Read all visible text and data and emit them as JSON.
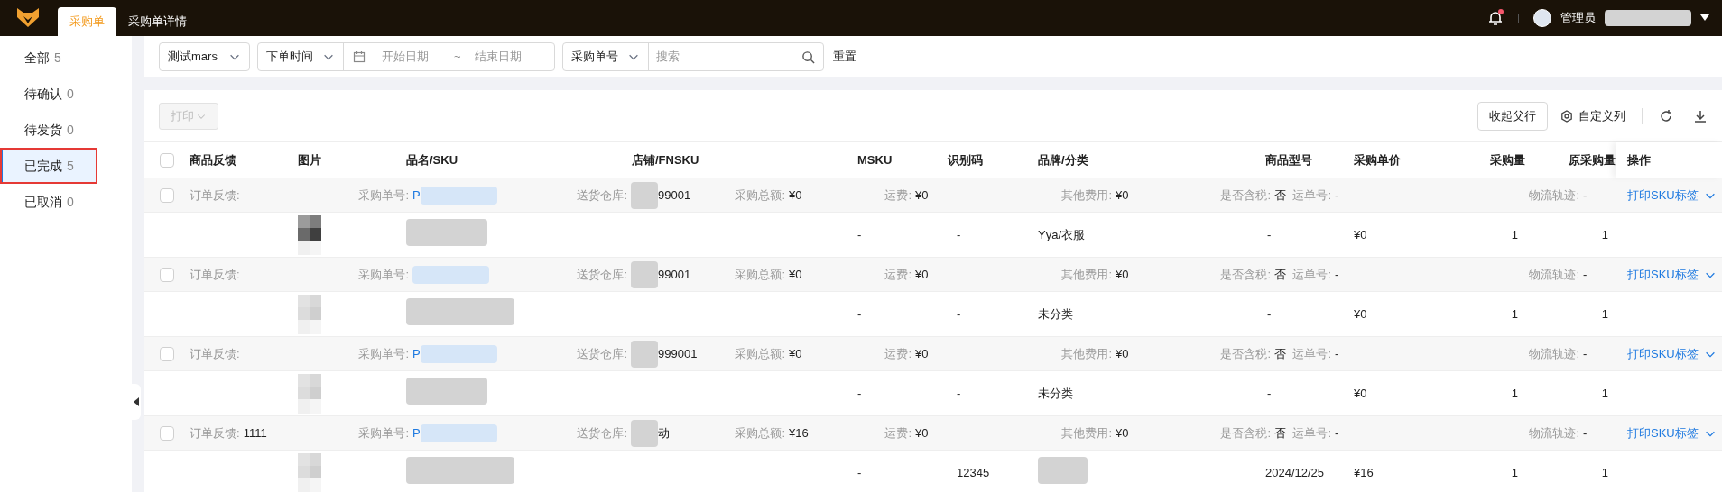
{
  "topbar": {
    "tabs": [
      {
        "label": "采购单",
        "selected": true
      },
      {
        "label": "采购单详情",
        "selected": false
      }
    ],
    "notification": {
      "unread": true
    },
    "user": {
      "name": "管理员"
    }
  },
  "sidebar": {
    "items": [
      {
        "label": "全部",
        "count": "5",
        "selected": false
      },
      {
        "label": "待确认",
        "count": "0",
        "selected": false
      },
      {
        "label": "待发货",
        "count": "0",
        "selected": false
      },
      {
        "label": "已完成",
        "count": "5",
        "selected": true
      },
      {
        "label": "已取消",
        "count": "0",
        "selected": false
      }
    ]
  },
  "filters": {
    "store": "测试mars",
    "date_type": "下单时间",
    "start_placeholder": "开始日期",
    "separator": "~",
    "end_placeholder": "结束日期",
    "search_type": "采购单号",
    "search_placeholder": "搜索",
    "reset": "重置"
  },
  "toolbar": {
    "print": {
      "label": "打印",
      "disabled": true
    },
    "collapse": "收起父行",
    "custom_columns": "自定义列"
  },
  "table": {
    "select_all_checked": false,
    "columns": [
      "商品反馈",
      "图片",
      "品名/SKU",
      "店铺/FNSKU",
      "MSKU",
      "识别码",
      "品牌/分类",
      "商品型号",
      "采购单价",
      "采购量",
      "原采购量",
      "操作"
    ],
    "orders": [
      {
        "checked": false,
        "fields": [
          {
            "label": "订单反馈:"
          },
          {
            "label": "采购单号:",
            "value": "P"
          },
          {
            "label": "送货仓库:",
            "value": "99001"
          },
          {
            "label": "采购总额:",
            "value": "¥0"
          },
          {
            "label": "运费:",
            "value": "¥0"
          },
          {
            "label": "其他费用:",
            "value": "¥0"
          },
          {
            "label": "是否含税:",
            "value": "否"
          },
          {
            "label": "运单号:",
            "value": "-"
          },
          {
            "label": "物流轨迹:",
            "value": "-"
          }
        ],
        "action": "打印SKU标签",
        "item": {
          "msku": "-",
          "code": "-",
          "brand": "Yya/衣服",
          "model": "-",
          "price": "¥0",
          "qty": "1",
          "orig_qty": "1"
        }
      },
      {
        "checked": false,
        "fields": [
          {
            "label": "订单反馈:"
          },
          {
            "label": "采购单号:"
          },
          {
            "label": "送货仓库:",
            "value": "99001"
          },
          {
            "label": "采购总额:",
            "value": "¥0"
          },
          {
            "label": "运费:",
            "value": "¥0"
          },
          {
            "label": "其他费用:",
            "value": "¥0"
          },
          {
            "label": "是否含税:",
            "value": "否"
          },
          {
            "label": "运单号:",
            "value": "-"
          },
          {
            "label": "物流轨迹:",
            "value": "-"
          }
        ],
        "action": "打印SKU标签",
        "item": {
          "msku": "-",
          "code": "-",
          "brand": "未分类",
          "model": "-",
          "price": "¥0",
          "qty": "1",
          "orig_qty": "1"
        }
      },
      {
        "checked": false,
        "fields": [
          {
            "label": "订单反馈:"
          },
          {
            "label": "采购单号:",
            "value": "P"
          },
          {
            "label": "送货仓库:",
            "value": "999001"
          },
          {
            "label": "采购总额:",
            "value": "¥0"
          },
          {
            "label": "运费:",
            "value": "¥0"
          },
          {
            "label": "其他费用:",
            "value": "¥0"
          },
          {
            "label": "是否含税:",
            "value": "否"
          },
          {
            "label": "运单号:",
            "value": "-"
          },
          {
            "label": "物流轨迹:",
            "value": "-"
          }
        ],
        "action": "打印SKU标签",
        "item": {
          "msku": "-",
          "code": "-",
          "brand": "未分类",
          "model": "-",
          "price": "¥0",
          "qty": "1",
          "orig_qty": "1"
        }
      },
      {
        "checked": false,
        "fields": [
          {
            "label": "订单反馈:",
            "value": "1111"
          },
          {
            "label": "采购单号:",
            "value": "P"
          },
          {
            "label": "送货仓库:",
            "value": "动"
          },
          {
            "label": "采购总额:",
            "value": "¥16"
          },
          {
            "label": "运费:",
            "value": "¥0"
          },
          {
            "label": "其他费用:",
            "value": "¥0"
          },
          {
            "label": "是否含税:",
            "value": "否"
          },
          {
            "label": "运单号:",
            "value": "-"
          },
          {
            "label": "物流轨迹:",
            "value": "-"
          }
        ],
        "action": "打印SKU标签",
        "item": {
          "msku": "-",
          "code": "12345",
          "model": "2024/12/25",
          "price": "¥16",
          "qty": "1",
          "orig_qty": "1"
        }
      }
    ]
  }
}
